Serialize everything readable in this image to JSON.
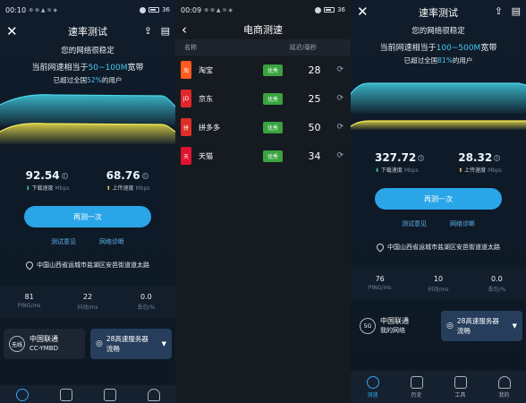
{
  "panel1": {
    "status": {
      "time": "00:10",
      "icons": "⊗ ⊗ ▲ ≋ ◈",
      "battery": "36"
    },
    "title": "速率测试",
    "summary": {
      "line1": "您的网络很稳定",
      "line2_prefix": "当前网速相当于",
      "line2_value": "50~100M",
      "line2_suffix": "宽带",
      "line3_prefix": "已超过全国",
      "line3_value": "52%",
      "line3_suffix": "的用户"
    },
    "download": {
      "value": "92.54",
      "label": "下载速度",
      "unit": "Mbps"
    },
    "upload": {
      "value": "68.76",
      "label": "上传速度",
      "unit": "Mbps"
    },
    "retest_label": "再测一次",
    "links": [
      "测试意见",
      "网络诊断"
    ],
    "address": "中国山西省运城市盐湖区安邑街道道太路",
    "stats": [
      {
        "value": "81",
        "label": "PING/ms"
      },
      {
        "value": "22",
        "label": "抖动/ms"
      },
      {
        "value": "0.0",
        "label": "丢包/%"
      }
    ],
    "carrier": {
      "badge": "无线",
      "name": "中国联通",
      "sub": "CC-YMBD"
    },
    "server": {
      "name": "28高速服务器",
      "sub": "流畅"
    }
  },
  "panel2": {
    "status": {
      "time": "00:09",
      "icons": "⊗ ⊗ ▲ ≋ ◈",
      "battery": "36"
    },
    "title": "电商测速",
    "header": {
      "name": "名称",
      "latency": "延迟/毫秒"
    },
    "rows": [
      {
        "name": "淘宝",
        "tag": "优秀",
        "latency": "28",
        "logo": "淘",
        "color": "#ff5a1f"
      },
      {
        "name": "京东",
        "tag": "优秀",
        "latency": "25",
        "logo": "JD",
        "color": "#e3262b"
      },
      {
        "name": "拼多多",
        "tag": "优秀",
        "latency": "50",
        "logo": "拼",
        "color": "#e02e24"
      },
      {
        "name": "天猫",
        "tag": "优秀",
        "latency": "34",
        "logo": "天",
        "color": "#e0132f"
      }
    ]
  },
  "panel3": {
    "title": "速率测试",
    "summary": {
      "line1": "您的网络很稳定",
      "line2_prefix": "当前网速相当于",
      "line2_value": "100~500M",
      "line2_suffix": "宽带",
      "line3_prefix": "已超过全国",
      "line3_value": "81%",
      "line3_suffix": "的用户"
    },
    "download": {
      "value": "327.72",
      "label": "下载速度",
      "unit": "Mbps"
    },
    "upload": {
      "value": "28.32",
      "label": "上传速度",
      "unit": "Mbps"
    },
    "retest_label": "再测一次",
    "links": [
      "测试意见",
      "网络诊断"
    ],
    "address": "中国山西省运城市盐湖区安邑街道道太路",
    "stats": [
      {
        "value": "76",
        "label": "PING/ms"
      },
      {
        "value": "10",
        "label": "抖动/ms"
      },
      {
        "value": "0.0",
        "label": "丢包/%"
      }
    ],
    "carrier": {
      "badge": "5G",
      "name": "中国联通",
      "sub": "我的网络"
    },
    "server": {
      "name": "28高速服务器",
      "sub": "流畅"
    },
    "nav": [
      "测速",
      "历史",
      "工具",
      "我的"
    ]
  },
  "colors": {
    "accent": "#29a5e8",
    "cyan_wave": "#3ec3d6",
    "yellow_wave": "#f1e34a",
    "good_tag": "#3aa33f"
  }
}
